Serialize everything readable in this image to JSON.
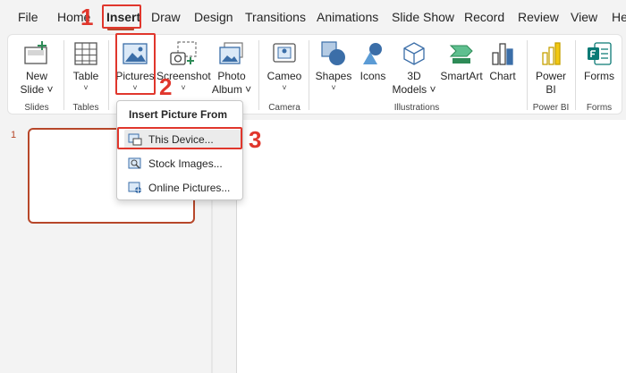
{
  "tabs": [
    "File",
    "Home",
    "Insert",
    "Draw",
    "Design",
    "Transitions",
    "Animations",
    "Slide Show",
    "Record",
    "Review",
    "View",
    "He"
  ],
  "active_tab": "Insert",
  "steps": [
    "1",
    "2",
    "3"
  ],
  "ribbon": {
    "new_slide": [
      "New",
      "Slide"
    ],
    "table": "Table",
    "pictures": "Pictures",
    "screenshot": "Screenshot",
    "photo_album": [
      "Photo",
      "Album"
    ],
    "cameo": "Cameo",
    "shapes": "Shapes",
    "icons": "Icons",
    "models_3d": [
      "3D",
      "Models"
    ],
    "smartart": "SmartArt",
    "chart": "Chart",
    "power_bi": [
      "Power",
      "BI"
    ],
    "forms": "Forms",
    "groups": {
      "slides": "Slides",
      "tables": "Tables",
      "camera": "Camera",
      "illustrations": "Illustrations",
      "power_bi": "Power BI",
      "forms": "Forms"
    }
  },
  "dropdown": {
    "title": "Insert Picture From",
    "items": [
      "This Device...",
      "Stock Images...",
      "Online Pictures..."
    ]
  },
  "slide_thumbnail_number": "1",
  "colors": {
    "accent": "#b7472a",
    "annotation": "#e0362c"
  }
}
